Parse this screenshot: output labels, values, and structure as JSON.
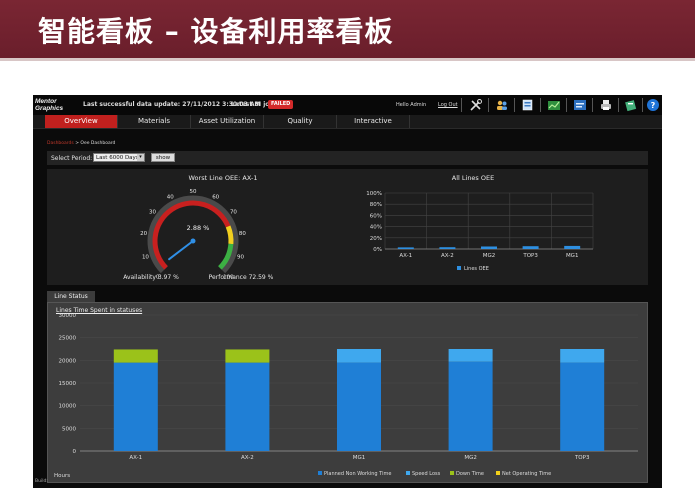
{
  "slide": {
    "title": "智能看板 – 设备利用率看板"
  },
  "app": {
    "logo": {
      "line1": "Mentor",
      "line2": "Graphics"
    },
    "last_update": "Last successful data update: 27/11/2012 3:30:03 AM",
    "latest_bi_job": "Latest BI job",
    "job_status": "FAILED",
    "hello": "Hello Admin",
    "logout": "Log Out",
    "toolbar_icons": [
      "tools-icon",
      "users-icon",
      "edit-icon",
      "chart-icon",
      "report-icon",
      "print-icon",
      "export-icon",
      "help-icon"
    ]
  },
  "nav": {
    "tabs": [
      "OverView",
      "Materials",
      "Asset Utilization",
      "Quality",
      "Interactive"
    ],
    "active": 0
  },
  "breadcrumb": {
    "first": "Dashboards",
    "sep": " > ",
    "current": "Oee Dashboard"
  },
  "period": {
    "label": "Select Period:",
    "value": "Last 6000 Days",
    "button": "show"
  },
  "gauge": {
    "title": "Worst Line OEE: AX-1",
    "value": 2.88,
    "value_label": "2.88 %",
    "min": 0,
    "max": 100,
    "ticks": [
      "0",
      "10",
      "20",
      "30",
      "40",
      "50",
      "60",
      "70",
      "80",
      "90",
      "100"
    ],
    "availability": "Availability 3.97 %",
    "performance": "Performance 72.59 %"
  },
  "chart_data": [
    {
      "type": "bar",
      "title": "All Lines OEE",
      "categories": [
        "AX-1",
        "AX-2",
        "MG2",
        "TOP3",
        "MG1"
      ],
      "series": [
        {
          "name": "Lines OEE",
          "values": [
            2.9,
            3.2,
            4.5,
            5.0,
            5.5
          ]
        }
      ],
      "ylim": [
        0,
        100
      ],
      "yticks": [
        "0%",
        "20%",
        "40%",
        "60%",
        "80%",
        "100%"
      ],
      "legend": "bottom",
      "colors": [
        "#2e8fe0"
      ]
    },
    {
      "type": "bar",
      "title": "Lines Time Spent in statuses",
      "ylabel": "Hours",
      "categories": [
        "AX-1",
        "AX-2",
        "MG1",
        "MG2",
        "TOP3"
      ],
      "ylim": [
        0,
        30000
      ],
      "yticks": [
        "0",
        "5000",
        "10000",
        "15000",
        "20000",
        "25000",
        "30000"
      ],
      "series": [
        {
          "name": "Planned Non Working Time",
          "values": [
            19500,
            19500,
            19500,
            19700,
            19500
          ],
          "color": "#1f7fd6"
        },
        {
          "name": "Speed Loss",
          "values": [
            0,
            0,
            3000,
            2800,
            3000
          ],
          "color": "#3fa8ee"
        },
        {
          "name": "Down Time",
          "values": [
            2900,
            2900,
            0,
            0,
            0
          ],
          "color": "#9bc21a"
        },
        {
          "name": "Net Operating Time",
          "values": [
            0,
            0,
            0,
            0,
            0
          ],
          "color": "#f2d01a"
        }
      ],
      "legend": "bottom"
    }
  ],
  "status_tab": "Line Status",
  "build": "Build:"
}
